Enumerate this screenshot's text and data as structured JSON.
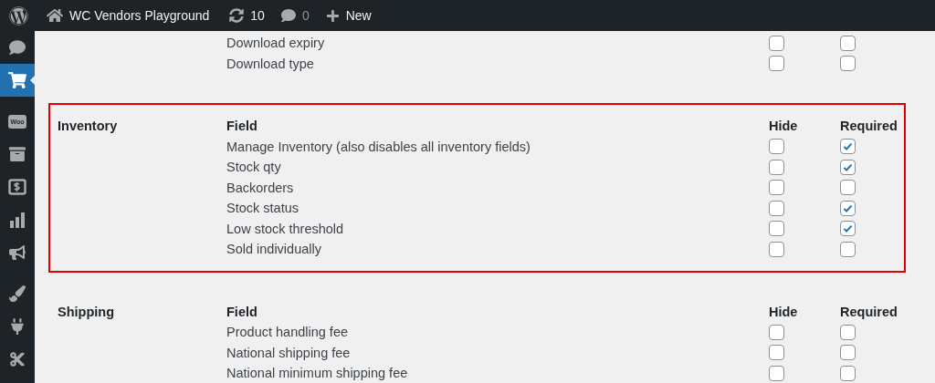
{
  "admin_bar": {
    "site_title": "WC Vendors Playground",
    "updates": "10",
    "comments": "0",
    "new_label": "New"
  },
  "sidebar": {
    "groups": [
      [
        {
          "kind": "comments",
          "selected": false
        },
        {
          "kind": "cart",
          "selected": true
        }
      ],
      [
        {
          "kind": "woo",
          "label": "Woo",
          "selected": false
        },
        {
          "kind": "archive",
          "selected": false
        },
        {
          "kind": "money",
          "selected": false
        },
        {
          "kind": "chart",
          "selected": false
        },
        {
          "kind": "megaphone",
          "selected": false
        }
      ],
      [
        {
          "kind": "brush",
          "selected": false
        },
        {
          "kind": "plug",
          "selected": false
        },
        {
          "kind": "scissors",
          "selected": false
        }
      ]
    ]
  },
  "sections": [
    {
      "highlighted": false,
      "rows": [
        {
          "field": "Download expiry",
          "hide": false,
          "required": false
        },
        {
          "field": "Download type",
          "hide": false,
          "required": false
        }
      ]
    },
    {
      "title": "Inventory",
      "highlighted": true,
      "columns": [
        "Field",
        "Hide",
        "Required"
      ],
      "rows": [
        {
          "field": "Manage Inventory (also disables all inventory fields)",
          "hide": false,
          "required": true
        },
        {
          "field": "Stock qty",
          "hide": false,
          "required": true
        },
        {
          "field": "Backorders",
          "hide": false,
          "required": false
        },
        {
          "field": "Stock status",
          "hide": false,
          "required": true
        },
        {
          "field": "Low stock threshold",
          "hide": false,
          "required": true
        },
        {
          "field": "Sold individually",
          "hide": false,
          "required": false
        }
      ]
    },
    {
      "title": "Shipping",
      "highlighted": false,
      "columns": [
        "Field",
        "Hide",
        "Required"
      ],
      "rows": [
        {
          "field": "Product handling fee",
          "hide": false,
          "required": false
        },
        {
          "field": "National shipping fee",
          "hide": false,
          "required": false
        },
        {
          "field": "National minimum shipping fee",
          "hide": false,
          "required": false
        }
      ]
    }
  ]
}
